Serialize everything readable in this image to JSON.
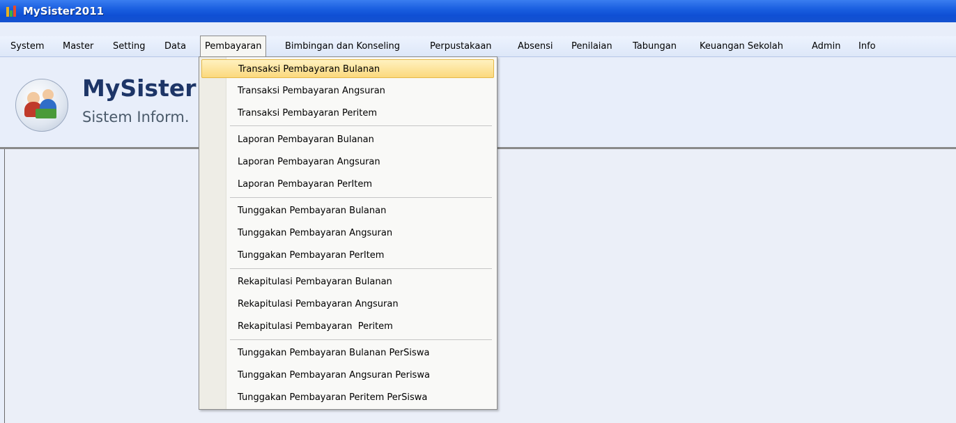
{
  "window": {
    "title": "MySister2011"
  },
  "menubar": {
    "items": [
      {
        "label": "System"
      },
      {
        "label": "Master"
      },
      {
        "label": "Setting"
      },
      {
        "label": "Data"
      },
      {
        "label": "Pembayaran",
        "active": true
      },
      {
        "label": "Bimbingan dan Konseling"
      },
      {
        "label": "Perpustakaan"
      },
      {
        "label": "Absensi"
      },
      {
        "label": "Penilaian"
      },
      {
        "label": "Tabungan"
      },
      {
        "label": "Keuangan Sekolah"
      },
      {
        "label": "Admin"
      },
      {
        "label": "Info"
      }
    ]
  },
  "header": {
    "app_name": "MySister",
    "subtitle": "Sistem Inform."
  },
  "dropdown": {
    "items": [
      {
        "label": "Transaksi Pembayaran Bulanan",
        "highlighted": true
      },
      {
        "label": "Transaksi Pembayaran Angsuran"
      },
      {
        "label": "Transaksi Pembayaran Peritem"
      },
      {
        "label": "Laporan Pembayaran Bulanan"
      },
      {
        "label": "Laporan Pembayaran Angsuran"
      },
      {
        "label": "Laporan Pembayaran PerItem"
      },
      {
        "label": "Tunggakan Pembayaran Bulanan"
      },
      {
        "label": "Tunggakan Pembayaran Angsuran"
      },
      {
        "label": "Tunggakan Pembayaran PerItem"
      },
      {
        "label": "Rekapitulasi Pembayaran Bulanan"
      },
      {
        "label": "Rekapitulasi Pembayaran Angsuran"
      },
      {
        "label": "Rekapitulasi Pembayaran  Peritem"
      },
      {
        "label": "Tunggakan Pembayaran Bulanan PerSiswa"
      },
      {
        "label": "Tunggakan Pembayaran Angsuran Periswa"
      },
      {
        "label": "Tunggakan Pembayaran Peritem PerSiswa"
      }
    ]
  },
  "colors": {
    "titlebar": "#1a5fe0",
    "highlight": "#fbd97d",
    "app_name": "#1d3567"
  }
}
